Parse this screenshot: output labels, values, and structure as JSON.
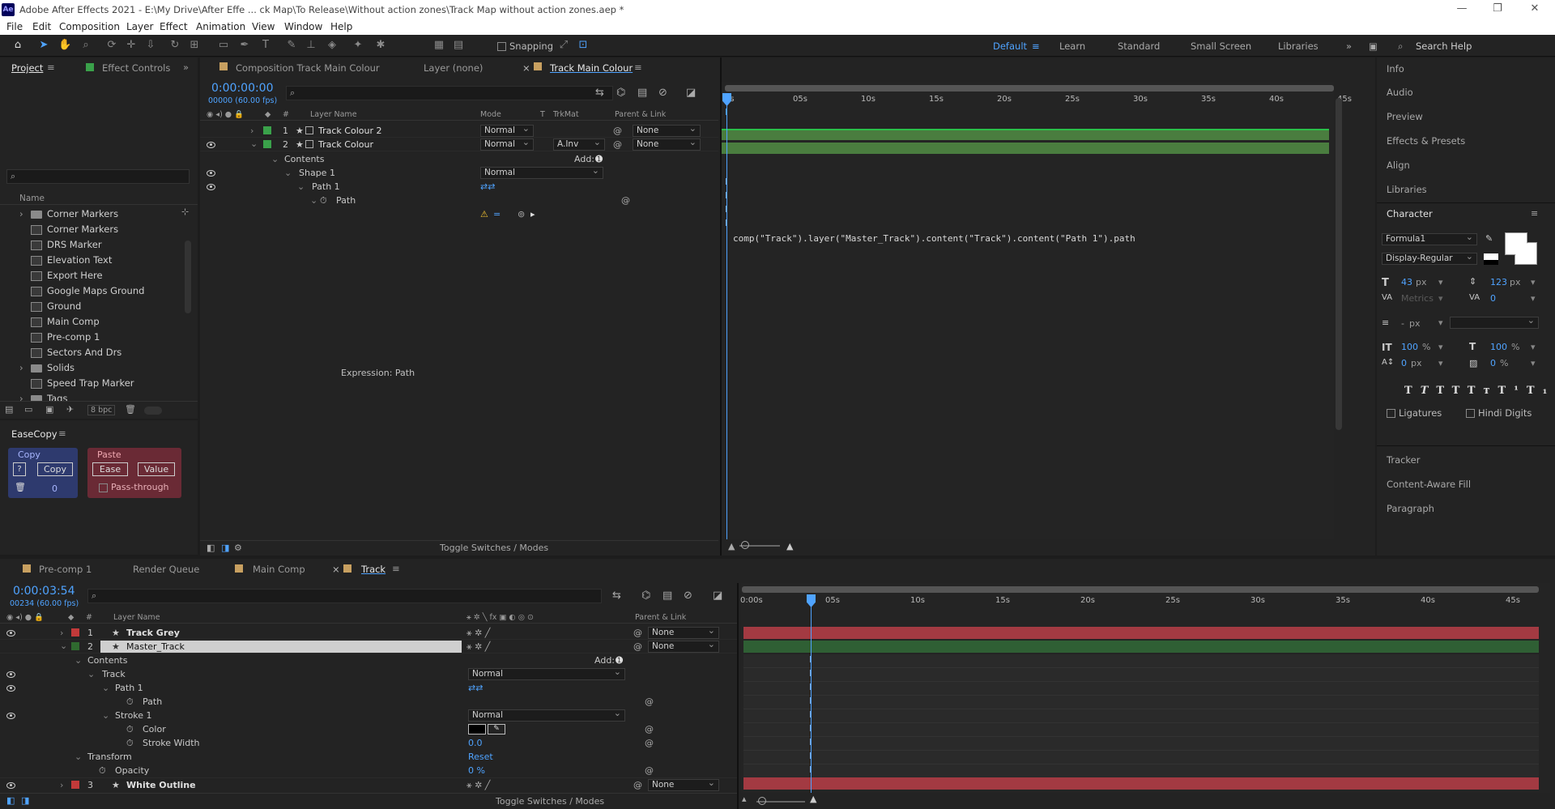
{
  "app": {
    "title": "Adobe After Effects 2021 - E:\\My Drive\\After Effe ... ck Map\\To Release\\Without action zones\\Track Map without action zones.aep *",
    "logo": "Ae"
  },
  "menu": [
    "File",
    "Edit",
    "Composition",
    "Layer",
    "Effect",
    "Animation",
    "View",
    "Window",
    "Help"
  ],
  "toolbar": {
    "snapping": "Snapping",
    "workspaces": [
      "Default",
      "Learn",
      "Standard",
      "Small Screen",
      "Libraries"
    ],
    "active_workspace": "Default",
    "search_help": "Search Help"
  },
  "left_panel": {
    "tabs": [
      "Project",
      "Effect Controls"
    ],
    "search_placeholder": "",
    "col_name": "Name",
    "items": [
      {
        "label": "Corner Markers",
        "kind": "folder",
        "expand": true
      },
      {
        "label": "Corner Markers",
        "kind": "comp"
      },
      {
        "label": "DRS Marker",
        "kind": "comp"
      },
      {
        "label": "Elevation Text",
        "kind": "comp"
      },
      {
        "label": "Export Here",
        "kind": "comp"
      },
      {
        "label": "Google Maps Ground",
        "kind": "comp"
      },
      {
        "label": "Ground",
        "kind": "comp"
      },
      {
        "label": "Main Comp",
        "kind": "comp"
      },
      {
        "label": "Pre-comp 1",
        "kind": "comp"
      },
      {
        "label": "Sectors And Drs",
        "kind": "comp"
      },
      {
        "label": "Solids",
        "kind": "folder",
        "expand": true
      },
      {
        "label": "Speed Trap Marker",
        "kind": "comp"
      },
      {
        "label": "Tags",
        "kind": "folder",
        "expand": true
      }
    ],
    "bpc": "8 bpc"
  },
  "easecopy": {
    "title": "EaseCopy",
    "copy_group": "Copy",
    "help": "?",
    "copy_btn": "Copy",
    "count": "0",
    "paste_group": "Paste",
    "ease_btn": "Ease",
    "value_btn": "Value",
    "pass_through": "Pass-through"
  },
  "comp_viewer": {
    "tabs": [
      "Composition Track Main Colour",
      "Layer (none)",
      "Track Main Colour"
    ],
    "timecode": "0:00:00:00",
    "frames": "00000 (60.00 fps)",
    "cols": {
      "layer_name": "Layer Name",
      "mode": "Mode",
      "t": "T",
      "trkmat": "TrkMat",
      "parent": "Parent & Link"
    },
    "layers": [
      {
        "num": "1",
        "name": "Track Colour 2",
        "mode": "Normal",
        "trkmat": "",
        "parent": "None",
        "color": "#3aa14a"
      },
      {
        "num": "2",
        "name": "Track Colour",
        "mode": "Normal",
        "trkmat": "A.Inv",
        "parent": "None",
        "color": "#3aa14a"
      }
    ],
    "contents": "Contents",
    "add": "Add:",
    "shape1": "Shape 1",
    "shape1_mode": "Normal",
    "path1": "Path 1",
    "path": "Path",
    "expression_label": "Expression: Path",
    "expression": "comp(\"Track\").layer(\"Master_Track\").content(\"Track\").content(\"Path 1\").path",
    "ruler": [
      "0s",
      "05s",
      "10s",
      "15s",
      "20s",
      "25s",
      "30s",
      "35s",
      "40s",
      "45s"
    ],
    "toggle": "Toggle Switches / Modes"
  },
  "right_panel": {
    "items_top": [
      "Info",
      "Audio",
      "Preview",
      "Effects & Presets",
      "Align",
      "Libraries"
    ],
    "character": "Character",
    "font": "Formula1",
    "style": "Display-Regular",
    "size": "43",
    "size_unit": "px",
    "leading": "123",
    "leading_unit": "px",
    "kerning": "Metrics",
    "tracking": "0",
    "stroke_w": "-",
    "stroke_unit": "px",
    "vscale": "100",
    "hscale": "100",
    "pct": "%",
    "baseline": "0",
    "baseline_unit": "px",
    "tsume": "0",
    "tsume_unit": "%",
    "ligatures": "Ligatures",
    "hindi": "Hindi Digits",
    "items_bottom": [
      "Tracker",
      "Content-Aware Fill",
      "Paragraph"
    ]
  },
  "timeline": {
    "tabs": [
      "Pre-comp 1",
      "Render Queue",
      "Main Comp",
      "Track"
    ],
    "active_tab": "Track",
    "timecode": "0:00:03:54",
    "frames": "00234 (60.00 fps)",
    "cols": {
      "layer_name": "Layer Name",
      "parent": "Parent & Link"
    },
    "layers": [
      {
        "num": "1",
        "name": "Track Grey",
        "parent": "None",
        "color": "#c23a3a"
      },
      {
        "num": "2",
        "name": "Master_Track",
        "parent": "None",
        "color": "#2f6a2f"
      },
      {
        "num": "3",
        "name": "White Outline",
        "parent": "None",
        "color": "#c23a3a"
      }
    ],
    "contents": "Contents",
    "add": "Add:",
    "track": "Track",
    "track_mode": "Normal",
    "path1": "Path 1",
    "path": "Path",
    "stroke1": "Stroke 1",
    "stroke_mode": "Normal",
    "color": "Color",
    "stroke_width": "Stroke Width",
    "stroke_width_val": "0.0",
    "transform": "Transform",
    "reset": "Reset",
    "opacity": "Opacity",
    "opacity_val": "0 %",
    "ruler": [
      "0:00s",
      "05s",
      "10s",
      "15s",
      "20s",
      "25s",
      "30s",
      "35s",
      "40s",
      "45s"
    ],
    "toggle": "Toggle Switches / Modes"
  }
}
